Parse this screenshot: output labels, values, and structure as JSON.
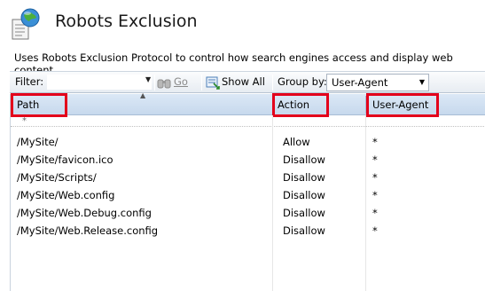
{
  "header": {
    "title": "Robots Exclusion",
    "icon": "globe-document-icon",
    "description": "Uses Robots Exclusion Protocol to control how search engines access and display web content"
  },
  "toolbar": {
    "filter_label": "Filter:",
    "filter_value": "",
    "go_label": "Go",
    "show_all_label": "Show All",
    "group_by_label": "Group by:",
    "group_by_value": "User-Agent"
  },
  "table": {
    "columns": [
      "Path",
      "Action",
      "User-Agent"
    ],
    "new_row_marker": "*",
    "rows": [
      {
        "path": "/MySite/",
        "action": "Allow",
        "agent": "*"
      },
      {
        "path": "/MySite/favicon.ico",
        "action": "Disallow",
        "agent": "*"
      },
      {
        "path": "/MySite/Scripts/",
        "action": "Disallow",
        "agent": "*"
      },
      {
        "path": "/MySite/Web.config",
        "action": "Disallow",
        "agent": "*"
      },
      {
        "path": "/MySite/Web.Debug.config",
        "action": "Disallow",
        "agent": "*"
      },
      {
        "path": "/MySite/Web.Release.config",
        "action": "Disallow",
        "agent": "*"
      }
    ]
  },
  "colors": {
    "highlight": "#e3001b",
    "header_gradient_top": "#dbe8f6",
    "header_gradient_bottom": "#c7d9ed"
  }
}
